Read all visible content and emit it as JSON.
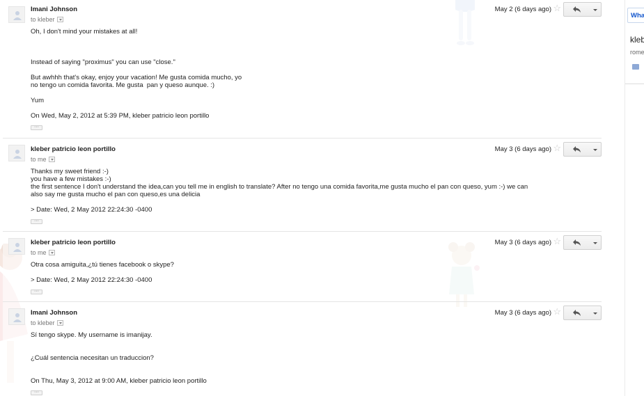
{
  "messages": [
    {
      "sender": "Imani Johnson",
      "to": "to kleber",
      "date": "May 2 (6 days ago)",
      "lines": [
        "Oh, I don't mind your mistakes at all!",
        "Instead of saying \"proximus\" you can use \"close.\"",
        "But awhhh that's okay, enjoy your vacation! Me gusta comida mucho, yo",
        "no tengo un comida favorita. Me gusta  pan y queso aunque. :)",
        "Yum",
        "On Wed, May 2, 2012 at 5:39 PM, kleber patricio leon portillo"
      ]
    },
    {
      "sender": "kleber patricio leon portillo",
      "to": "to me",
      "date": "May 3 (6 days ago)",
      "lines": [
        "Thanks my sweet friend :-)",
        "you have a few mistakes :-)",
        "the first sentence I don't understand the idea,can you tell me in english to translate? After no tengo una comida favorita,me gusta mucho el pan con queso, yum :-) we can",
        "also say me gusta mucho el pan con queso,es una delicia",
        "> Date: Wed, 2 May 2012 22:24:30 -0400"
      ]
    },
    {
      "sender": "kleber patricio leon portillo",
      "to": "to me",
      "date": "May 3 (6 days ago)",
      "lines": [
        "Otra cosa amiguita,¿tú tienes facebook o skype?",
        "> Date: Wed, 2 May 2012 22:24:30 -0400"
      ]
    },
    {
      "sender": "Imani Johnson",
      "to": "to kleber",
      "date": "May 3 (6 days ago)",
      "lines": [
        "Sí tengo skype. My username is imanijay.",
        "¿Cuál sentencia necesitan un traduccion?",
        "On Thu, May 3, 2012 at 9:00 AM, kleber patricio leon portillo"
      ]
    }
  ],
  "icons": {
    "star": "☆",
    "reply": "reply-arrow-icon",
    "more": "chevron-down-icon",
    "avatar": "person-silhouette-icon"
  },
  "ellipsis_label": "···",
  "right_panel": {
    "button_label": "Wha",
    "name": "kleb",
    "subtitle": "rome"
  },
  "colors": {
    "link_blue": "#1155cc",
    "star_gray": "#c8c8c8",
    "border": "#e5e5e5"
  }
}
